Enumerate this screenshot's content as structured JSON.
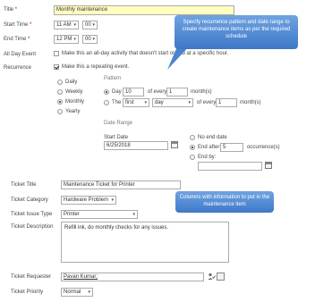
{
  "form": {
    "title_label": "Title",
    "title_required": "*",
    "title_value": "Monthly maintenance",
    "start_time_label": "Start Time",
    "start_time_required": "*",
    "start_date_value": "11 AM",
    "start_minutes_value": "00",
    "end_time_label": "End Time",
    "end_time_required": "*",
    "end_date_value": "12 PM",
    "end_minutes_value": "00",
    "all_day_label": "All Day Event",
    "all_day_text": "Make this an all-day activity that doesn't start or end at a specific hour.",
    "recurrence_label": "Recurrence",
    "recurrence_text": "Make this a repeating event.",
    "frequency_options": [
      "Daily",
      "Weekly",
      "Monthly",
      "Yearly"
    ],
    "pattern_heading": "Pattern",
    "day_label": "Day",
    "day_value": "10",
    "of_every_label": "of every",
    "months_value": "1",
    "months_label": "month(s)",
    "the_label": "The",
    "the_ordinal": "first",
    "the_day": "day",
    "of_every_label_2": "of every",
    "months_value_2": "1",
    "months_label_2": "month(s)",
    "date_range_heading": "Date Range",
    "start_date_label": "Start Date",
    "start_date_input": "6/25/2018",
    "no_end_date_label": "No end date",
    "end_after_label": "End after:",
    "end_after_value": "5",
    "occurrences_label": "occurrence(s)",
    "end_by_label": "End by:",
    "end_by_value": "",
    "ticket_title_label": "Ticket Title",
    "ticket_title_value": "Maintenance Ticket for Printer",
    "ticket_category_label": "Ticket Category",
    "ticket_category_value": "Hardware Problem",
    "ticket_issue_type_label": "Ticket Issue Type",
    "ticket_issue_type_value": "Printer",
    "ticket_description_label": "Ticket Description",
    "ticket_description_value": "Refill ink, do monthly checks for any issues.",
    "ticket_requester_label": "Ticket Requester",
    "ticket_requester_value": "Pavan Kumar;",
    "ticket_priority_label": "Ticket Priority",
    "ticket_priority_value": "Normal"
  },
  "callouts": {
    "recurrence_note": "Specify recurrence pattern and date range to create maintenance items as per the required schedule",
    "columns_note": "Columns with information to put in the maintenance item"
  },
  "icons": {
    "dropdown": "▾",
    "people_picker": "person-check-icon",
    "calendar": "calendar-icon"
  },
  "colors": {
    "title_highlight": "#ffffc0",
    "callout_top": "#6fa3e0",
    "callout_bottom": "#3e78c9",
    "required": "#bf0000"
  }
}
